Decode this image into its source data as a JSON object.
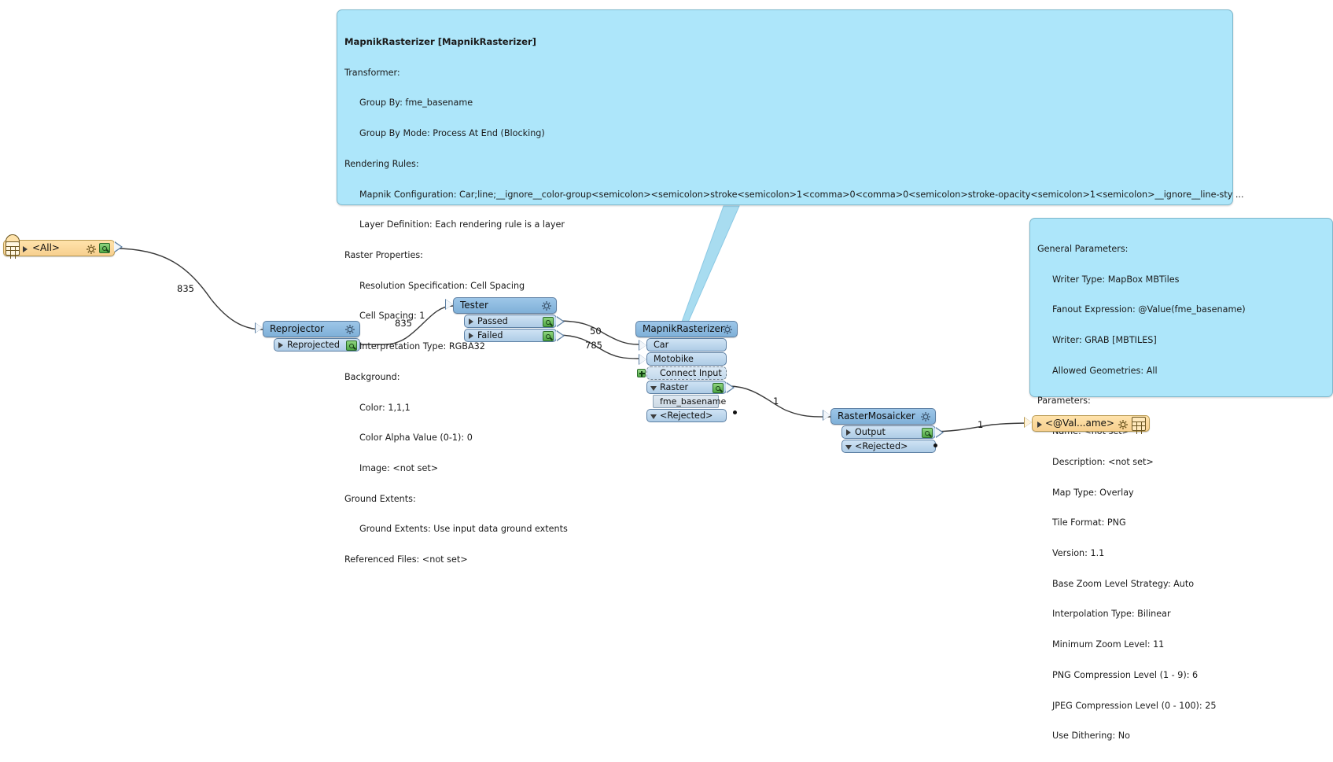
{
  "callouts": {
    "mapnik": {
      "name": "mapnik-annotation",
      "title": "MapnikRasterizer [MapnikRasterizer]",
      "lines": [
        {
          "indent": 0,
          "text": "Transformer:"
        },
        {
          "indent": 1,
          "text": "Group By: fme_basename"
        },
        {
          "indent": 1,
          "text": "Group By Mode: Process At End (Blocking)"
        },
        {
          "indent": 0,
          "text": "Rendering Rules:"
        },
        {
          "indent": 1,
          "text": "Mapnik Configuration: Car;line;__ignore__color-group<semicolon><semicolon>stroke<semicolon>1<comma>0<comma>0<semicolon>stroke-opacity<semicolon>1<semicolon>__ignore__line-sty ..."
        },
        {
          "indent": 1,
          "text": "Layer Definition: Each rendering rule is a layer"
        },
        {
          "indent": 0,
          "text": "Raster Properties:"
        },
        {
          "indent": 1,
          "text": "Resolution Specification: Cell Spacing"
        },
        {
          "indent": 1,
          "text": "Cell Spacing: 1"
        },
        {
          "indent": 1,
          "text": "Interpretation Type: RGBA32"
        },
        {
          "indent": 0,
          "text": "Background:"
        },
        {
          "indent": 1,
          "text": "Color: 1,1,1"
        },
        {
          "indent": 1,
          "text": "Color Alpha Value (0-1): 0"
        },
        {
          "indent": 1,
          "text": "Image: <not set>"
        },
        {
          "indent": 0,
          "text": "Ground Extents:"
        },
        {
          "indent": 1,
          "text": "Ground Extents: Use input data ground extents"
        },
        {
          "indent": 0,
          "text": "Referenced Files: <not set>"
        }
      ]
    },
    "writer": {
      "name": "writer-annotation",
      "title": "",
      "lines": [
        {
          "indent": 0,
          "text": "General Parameters:"
        },
        {
          "indent": 1,
          "text": "Writer Type: MapBox MBTiles"
        },
        {
          "indent": 1,
          "text": "Fanout Expression: @Value(fme_basename)"
        },
        {
          "indent": 1,
          "text": "Writer: GRAB [MBTILES]"
        },
        {
          "indent": 1,
          "text": "Allowed Geometries: All"
        },
        {
          "indent": 0,
          "text": "Parameters:"
        },
        {
          "indent": 1,
          "text": "Name: <not set>"
        },
        {
          "indent": 1,
          "text": "Description: <not set>"
        },
        {
          "indent": 1,
          "text": "Map Type: Overlay"
        },
        {
          "indent": 1,
          "text": "Tile Format: PNG"
        },
        {
          "indent": 1,
          "text": "Version: 1.1"
        },
        {
          "indent": 1,
          "text": "Base Zoom Level Strategy: Auto"
        },
        {
          "indent": 1,
          "text": "Interpolation Type: Bilinear"
        },
        {
          "indent": 1,
          "text": "Minimum Zoom Level: 11"
        },
        {
          "indent": 1,
          "text": "PNG Compression Level (1 - 9): 6"
        },
        {
          "indent": 1,
          "text": "JPEG Compression Level (0 - 100): 25"
        },
        {
          "indent": 1,
          "text": "Use Dithering: No"
        }
      ]
    }
  },
  "nodes": {
    "reader": {
      "name": "reader-node",
      "label": "<All>"
    },
    "reprojector": {
      "name": "reprojector-node",
      "title": "Reprojector",
      "ports": [
        {
          "label": "Reprojected",
          "kind": "output"
        }
      ]
    },
    "tester": {
      "name": "tester-node",
      "title": "Tester",
      "ports": [
        {
          "label": "Passed",
          "kind": "output"
        },
        {
          "label": "Failed",
          "kind": "output"
        }
      ]
    },
    "mapnik": {
      "name": "mapnikrasterizer-node",
      "title": "MapnikRasterizer",
      "ports": [
        {
          "label": "Car",
          "kind": "input"
        },
        {
          "label": "Motobike",
          "kind": "input"
        },
        {
          "label": "Connect Input",
          "kind": "connect"
        },
        {
          "label": "Raster",
          "kind": "output"
        },
        {
          "label": "fme_basename",
          "kind": "attribute"
        },
        {
          "label": "<Rejected>",
          "kind": "rejected"
        }
      ]
    },
    "mosaicker": {
      "name": "rastermosaicker-node",
      "title": "RasterMosaicker",
      "ports": [
        {
          "label": "Output",
          "kind": "output"
        },
        {
          "label": "<Rejected>",
          "kind": "rejected"
        }
      ]
    },
    "writer": {
      "name": "writer-node",
      "label": "<@Val...ame>"
    }
  },
  "wire_labels": [
    {
      "name": "wire-count-reader-reprojector",
      "text": "835"
    },
    {
      "name": "wire-count-reprojector-tester",
      "text": "835"
    },
    {
      "name": "wire-count-passed-car",
      "text": "50"
    },
    {
      "name": "wire-count-failed-motobike",
      "text": "785"
    },
    {
      "name": "wire-count-raster-mosaicker",
      "text": "1"
    },
    {
      "name": "wire-count-mosaicker-writer",
      "text": "1"
    }
  ],
  "colors": {
    "callout_bg": "#ade6fa",
    "callout_border": "#7fb8cc",
    "node_header": "#8fbbdf",
    "node_port": "#bfd8ee",
    "reader_bg": "#ffdfa3",
    "wire": "#3a3a3a",
    "leader": "#a8dcf0"
  }
}
